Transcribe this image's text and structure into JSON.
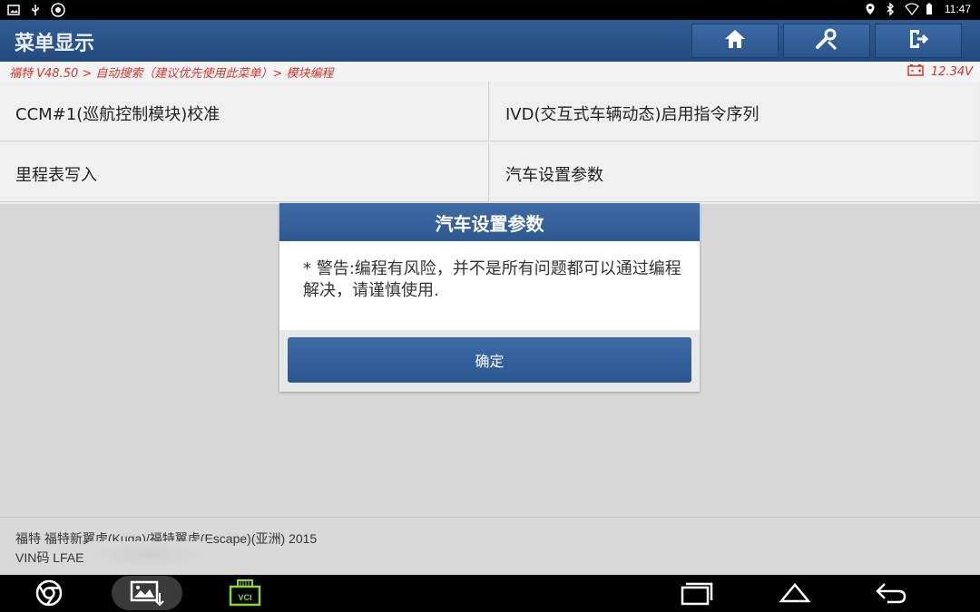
{
  "status_bar": {
    "time": "11:47",
    "left_icons": [
      "image-icon",
      "usb-icon",
      "settings-app-icon"
    ],
    "right_icons": [
      "location-icon",
      "bluetooth-icon",
      "wifi-icon",
      "battery-icon"
    ]
  },
  "header": {
    "title": "菜单显示",
    "buttons": [
      "home-icon",
      "diagnose-tool-icon",
      "exit-icon"
    ]
  },
  "breadcrumb": {
    "text": "福特 V48.50 > 自动搜索（建议优先使用此菜单）> 模块编程",
    "voltage": "12.34V"
  },
  "menu": {
    "items": [
      {
        "label": "CCM#1(巡航控制模块)校准"
      },
      {
        "label": "IVD(交互式车辆动态)启用指令序列"
      },
      {
        "label": "里程表写入"
      },
      {
        "label": "汽车设置参数"
      }
    ]
  },
  "dialog": {
    "title": "汽车设置参数",
    "message": "* 警告:编程有风险，并不是所有问题都可以通过编程解决，请谨慎使用.",
    "ok_label": "确定"
  },
  "vehicle_info": {
    "line1": "福特 福特新翼虎(Kuga)/福特翼虎(Escape)(亚洲) 2015",
    "line2": "VIN码 LFAE"
  },
  "nav_bar": {
    "vci_label": "VCI",
    "icons": [
      "chrome-icon",
      "gallery-icon",
      "vci-icon",
      "recents-icon",
      "home-nav-icon",
      "back-icon"
    ]
  },
  "colors": {
    "header": "#2f5c95",
    "accent_red": "#d9332b",
    "vci_green": "#8cd43a"
  }
}
